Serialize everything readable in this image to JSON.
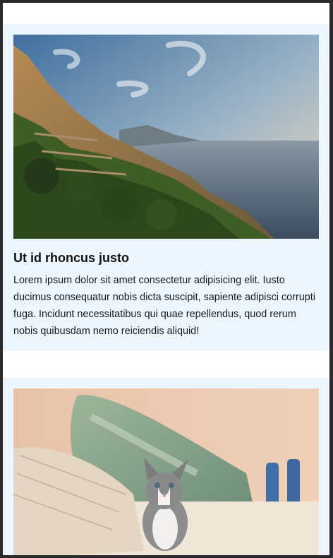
{
  "cards": [
    {
      "image_alt": "coastal landscape with cliffs and sea",
      "title": "Ut id rhoncus justo",
      "text": "Lorem ipsum dolor sit amet consectetur adipisicing elit. Iusto ducimus consequatur nobis dicta suscipit, sapiente adipisci corrupti fuga. Incidunt necessitatibus qui quae repellendus, quod rerum nobis quibusdam nemo reiciendis aliquid!"
    },
    {
      "image_alt": "grey and white kitten sitting on a bed with pillows"
    }
  ],
  "colors": {
    "card_background": "#eef6fd",
    "page_background": "#ffffff",
    "frame_border": "#2b2b2b"
  }
}
